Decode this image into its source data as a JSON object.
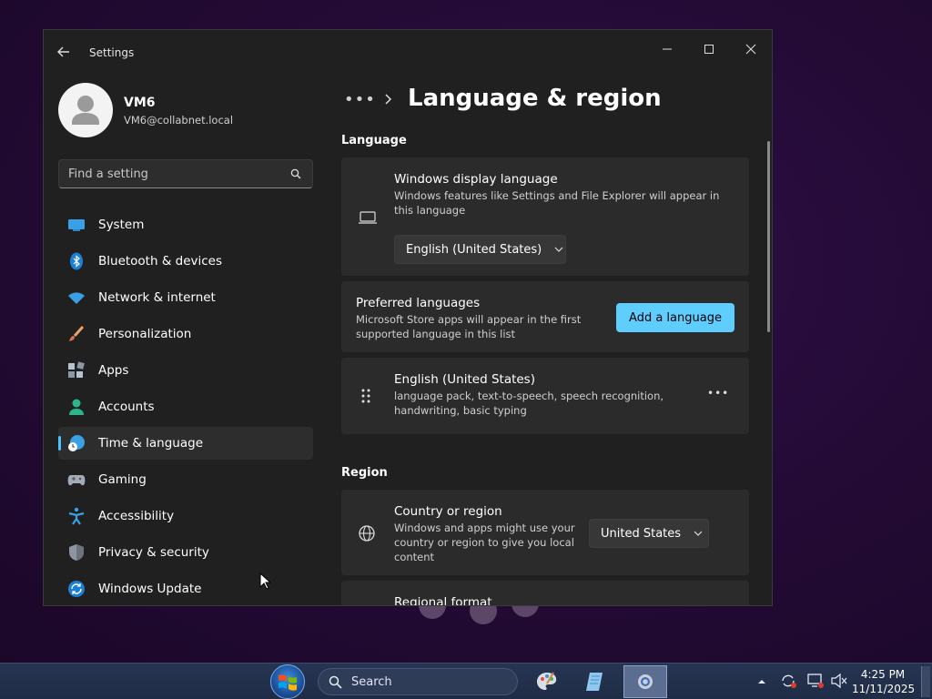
{
  "window": {
    "title": "Settings"
  },
  "profile": {
    "name": "VM6",
    "email": "VM6@collabnet.local"
  },
  "search": {
    "placeholder": "Find a setting"
  },
  "nav": [
    {
      "label": "System",
      "icon": "monitor-icon"
    },
    {
      "label": "Bluetooth & devices",
      "icon": "bluetooth-icon"
    },
    {
      "label": "Network & internet",
      "icon": "wifi-icon"
    },
    {
      "label": "Personalization",
      "icon": "brush-icon"
    },
    {
      "label": "Apps",
      "icon": "apps-icon"
    },
    {
      "label": "Accounts",
      "icon": "person-icon"
    },
    {
      "label": "Time & language",
      "icon": "globe-clock-icon",
      "active": true
    },
    {
      "label": "Gaming",
      "icon": "gamepad-icon"
    },
    {
      "label": "Accessibility",
      "icon": "accessibility-icon"
    },
    {
      "label": "Privacy & security",
      "icon": "shield-icon"
    },
    {
      "label": "Windows Update",
      "icon": "update-icon"
    }
  ],
  "breadcrumb": {
    "ellipsis": "•••",
    "title": "Language & region"
  },
  "language": {
    "heading": "Language",
    "display": {
      "title": "Windows display language",
      "description": "Windows features like Settings and File Explorer will appear in this language",
      "value": "English (United States)"
    },
    "preferred": {
      "title": "Preferred languages",
      "description": "Microsoft Store apps will appear in the first supported language in this list",
      "button": "Add a language"
    },
    "entry": {
      "title": "English (United States)",
      "description": "language pack, text-to-speech, speech recognition, handwriting, basic typing",
      "more": "•••"
    }
  },
  "region": {
    "heading": "Region",
    "country": {
      "title": "Country or region",
      "description": "Windows and apps might use your country or region to give you local content",
      "value": "United States"
    },
    "format": {
      "title": "Regional format"
    }
  },
  "taskbar": {
    "search_label": "Search",
    "time": "4:25 PM",
    "date": "11/11/2025"
  },
  "colors": {
    "accent": "#60cdff",
    "indicator": "#4cc2ff",
    "window_bg": "#202020",
    "card_bg": "#2b2b2b"
  }
}
